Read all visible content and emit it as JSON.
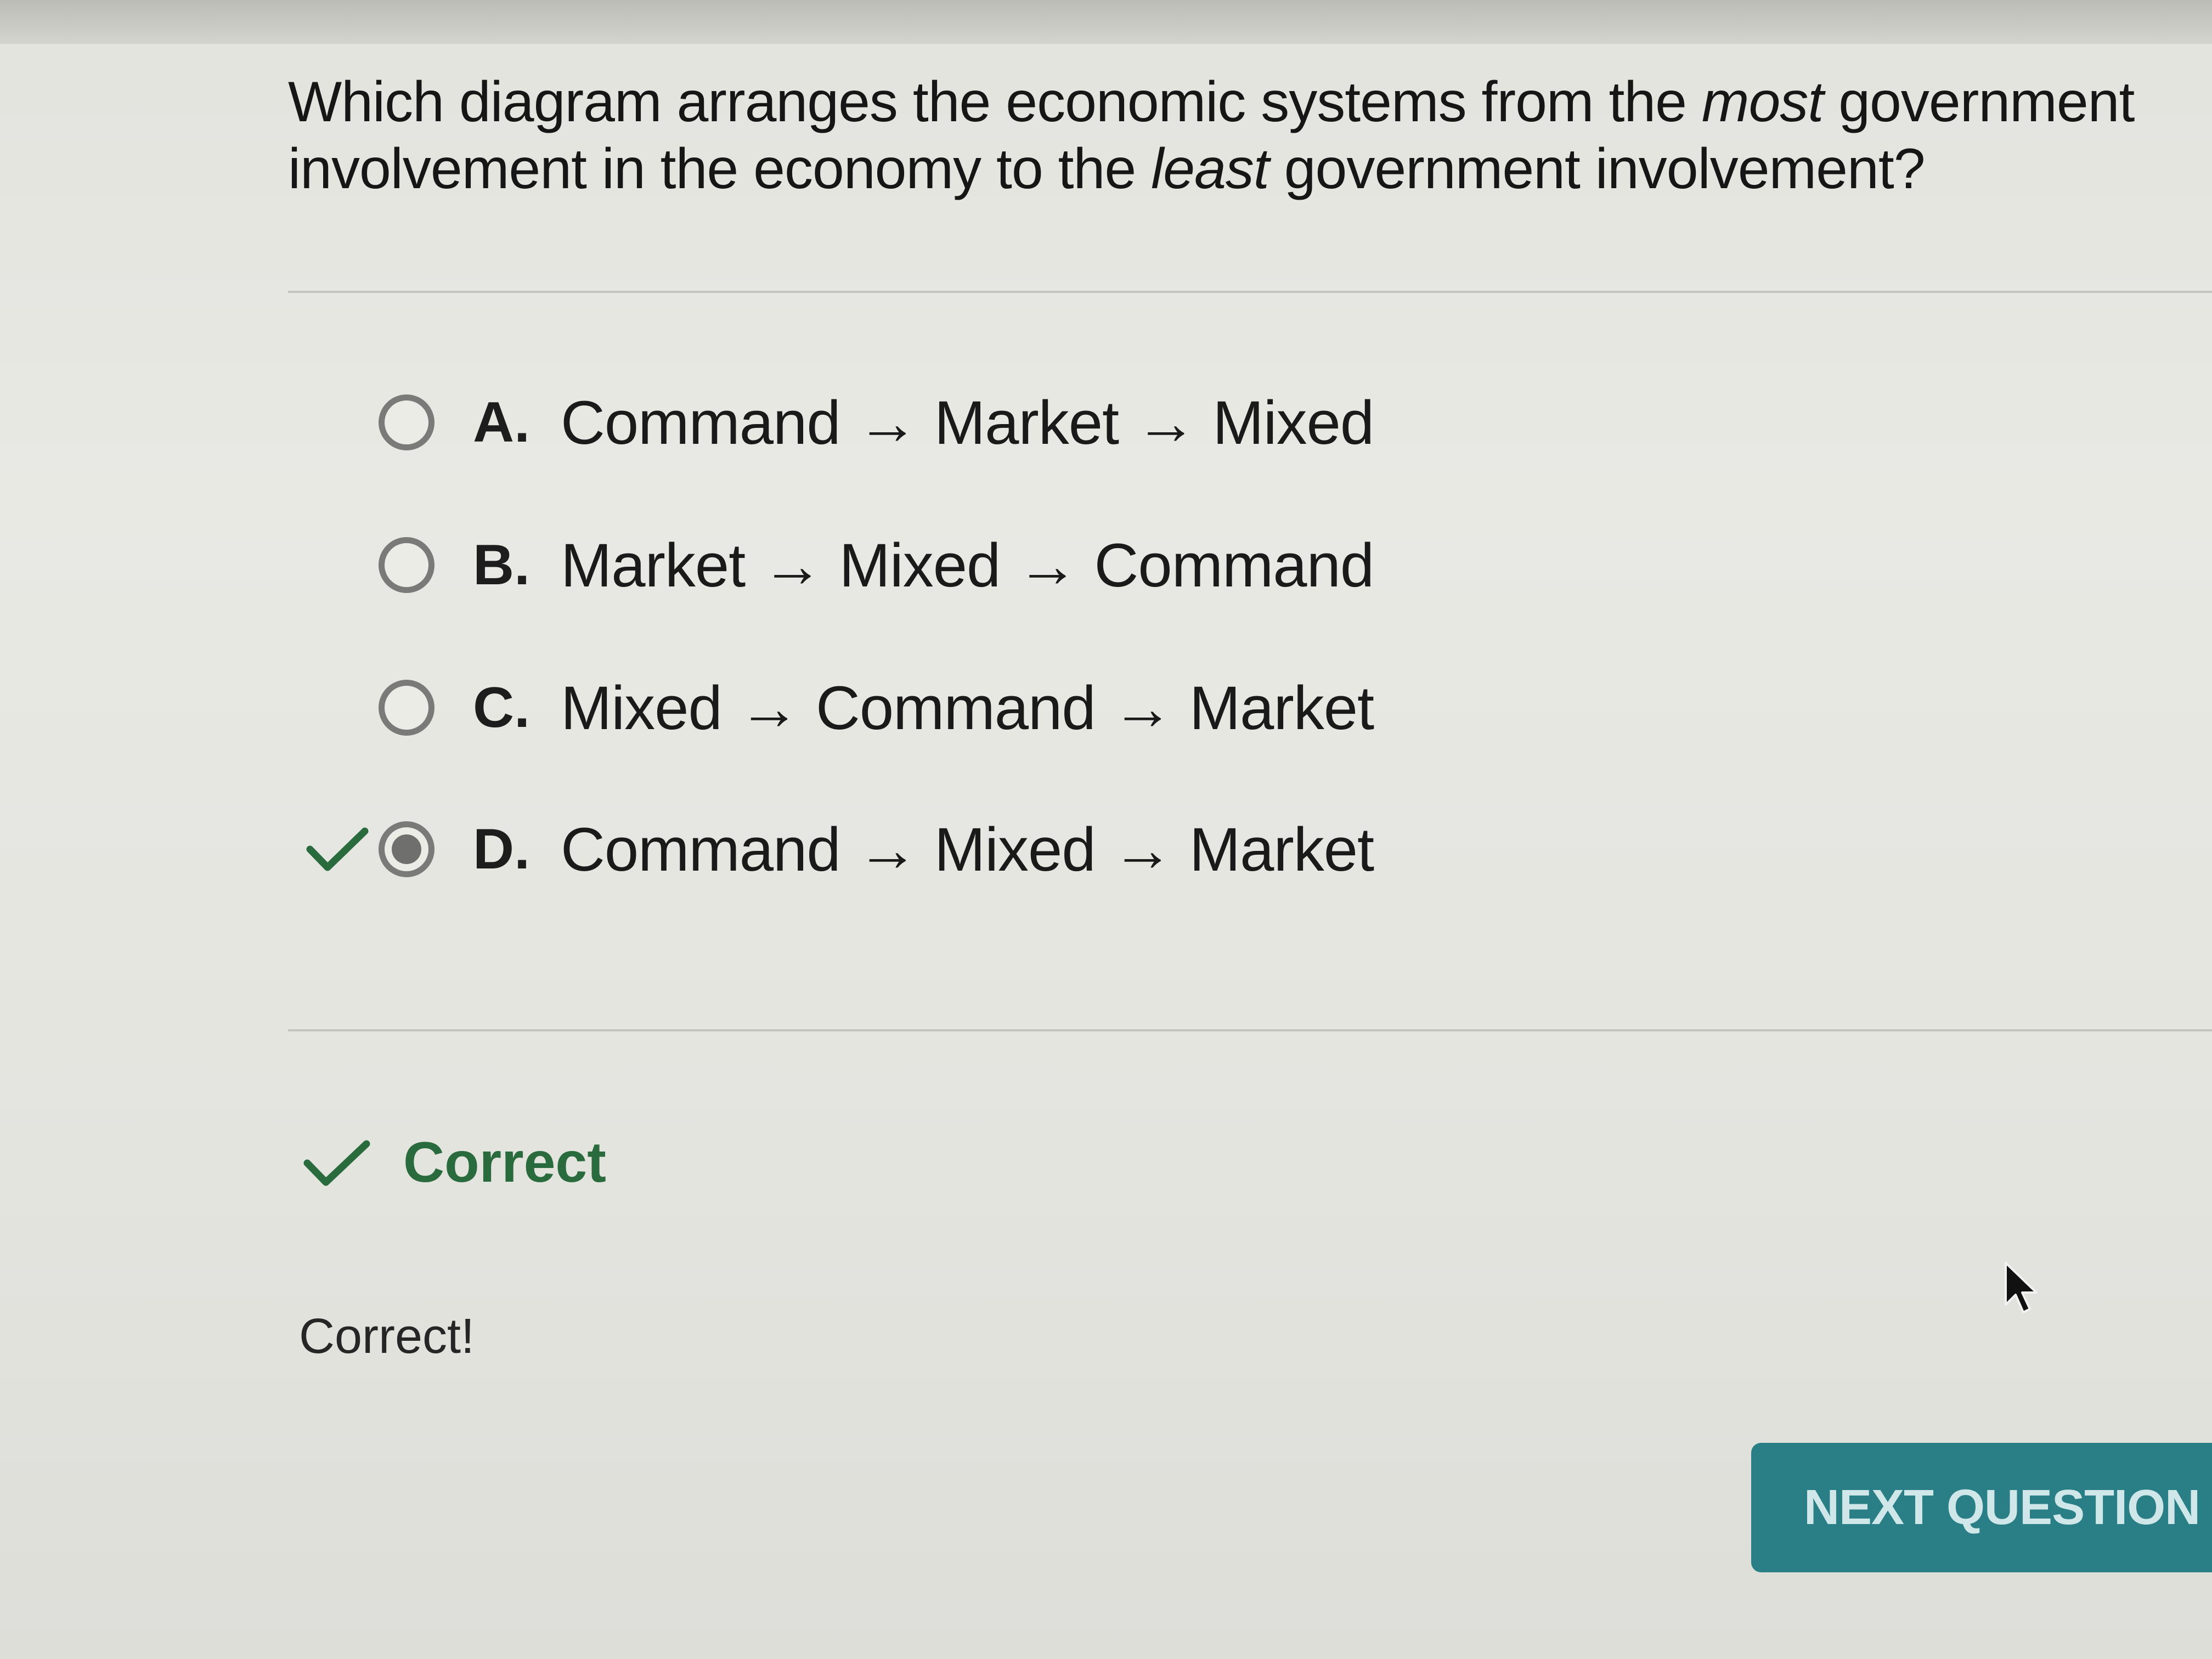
{
  "question": {
    "text_part1": "Which diagram arranges the economic systems from the ",
    "emphasis1": "most",
    "text_part2": " government involvement in the economy to the ",
    "emphasis2": "least",
    "text_part3": " government involvement?"
  },
  "options": [
    {
      "letter": "A.",
      "text": "Command → Market → Mixed",
      "selected": false
    },
    {
      "letter": "B.",
      "text": "Market → Mixed → Command",
      "selected": false
    },
    {
      "letter": "C.",
      "text": "Mixed → Command → Market",
      "selected": false
    },
    {
      "letter": "D.",
      "text": "Command → Mixed → Market",
      "selected": true,
      "marked_correct": true
    }
  ],
  "result": {
    "label": "Correct",
    "feedback": "Correct!",
    "icon": "check-icon"
  },
  "next_button": {
    "label": "NEXT QUESTION"
  },
  "colors": {
    "correct_green": "#2a6b3d",
    "button_teal": "#2a7f86"
  }
}
